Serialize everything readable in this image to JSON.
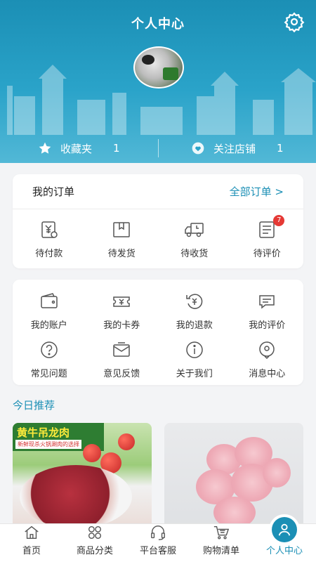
{
  "header": {
    "title": "个人中心"
  },
  "stats": {
    "favorites": {
      "label": "收藏夹",
      "count": "1"
    },
    "followed_shops": {
      "label": "关注店铺",
      "count": "1"
    }
  },
  "orders": {
    "title": "我的订单",
    "all_label": "全部订单 >",
    "items": [
      {
        "label": "待付款",
        "icon": "pending-payment-icon"
      },
      {
        "label": "待发货",
        "icon": "pending-shipment-icon"
      },
      {
        "label": "待收货",
        "icon": "delivery-truck-icon"
      },
      {
        "label": "待评价",
        "icon": "pending-review-icon",
        "badge": "7"
      }
    ]
  },
  "services": {
    "row1": [
      {
        "label": "我的账户",
        "icon": "wallet-icon"
      },
      {
        "label": "我的卡券",
        "icon": "coupon-icon"
      },
      {
        "label": "我的退款",
        "icon": "refund-icon"
      },
      {
        "label": "我的评价",
        "icon": "review-bubble-icon"
      }
    ],
    "row2": [
      {
        "label": "常见问题",
        "icon": "question-icon"
      },
      {
        "label": "意见反馈",
        "icon": "feedback-mail-icon"
      },
      {
        "label": "关于我们",
        "icon": "info-icon"
      },
      {
        "label": "消息中心",
        "icon": "location-pin-icon"
      }
    ]
  },
  "recommend": {
    "title": "今日推荐",
    "products": [
      {
        "banner_title": "黄牛吊龙肉",
        "banner_sub": "新鲜现杀火锅涮肉的选择"
      },
      {
        "image": "pink-carnation-bouquet"
      }
    ]
  },
  "tabbar": [
    {
      "label": "首页",
      "icon": "home-icon"
    },
    {
      "label": "商品分类",
      "icon": "category-icon"
    },
    {
      "label": "平台客服",
      "icon": "headset-icon"
    },
    {
      "label": "购物清单",
      "icon": "cart-icon"
    },
    {
      "label": "个人中心",
      "icon": "user-icon",
      "active": true
    }
  ],
  "colors": {
    "primary": "#1b8fb5",
    "badge": "#e53935",
    "background": "#f3f4f6"
  }
}
